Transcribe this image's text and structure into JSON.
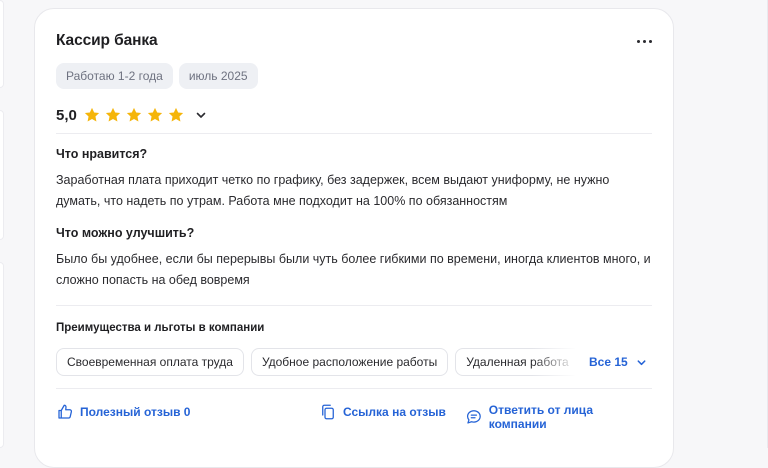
{
  "review": {
    "job_title": "Кассир банка",
    "tenure": "Работаю 1-2 года",
    "date": "июль 2025",
    "rating": "5,0",
    "stars": 5,
    "likes_heading": "Что нравится?",
    "likes_text": "Заработная плата приходит четко по графику, без задержек, всем выдают униформу, не нужно думать, что надеть по утрам. Работа мне подходит на 100% по обязанностям",
    "improve_heading": "Что можно улучшить?",
    "improve_text": "Было бы удобнее, если бы перерывы были чуть более гибкими по времени, иногда клиентов много, и сложно попасть на обед вовремя",
    "benefits_heading": "Преимущества и льготы в компании",
    "benefits": [
      "Своевременная оплата труда",
      "Удобное расположение работы",
      "Удаленная работа"
    ],
    "benefits_all": "Все 15"
  },
  "footer": {
    "helpful": "Полезный отзыв 0",
    "link": "Ссылка на отзыв",
    "reply": "Ответить от лица компании"
  },
  "colors": {
    "accent": "#2563d6",
    "star": "#f5b50a",
    "chip_bg": "#eef0f4"
  },
  "icons": [
    "more-icon",
    "star-icon",
    "chevron-down-icon",
    "thumbs-up-icon",
    "copy-link-icon",
    "chat-reply-icon"
  ]
}
